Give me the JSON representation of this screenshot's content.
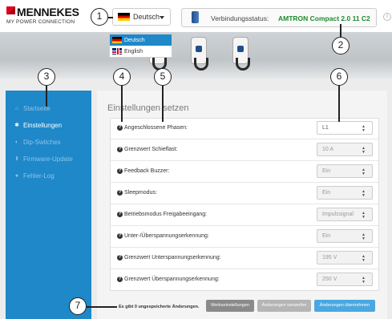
{
  "header": {
    "logo_brand": "MENNEKES",
    "logo_tagline": "MY POWER CONNECTION",
    "language_current": "Deutsch",
    "language_options": [
      "Deutsch",
      "English"
    ],
    "status_label": "Verbindungsstatus:",
    "status_value": "AMTRON Compact 2.0 11 C2",
    "info_icon": "i"
  },
  "sidebar": {
    "items": [
      {
        "label": "Startseite",
        "icon": "home-icon",
        "glyph": "⌂"
      },
      {
        "label": "Einstellungen",
        "icon": "gear-icon",
        "glyph": "✱"
      },
      {
        "label": "Dip-Switches",
        "icon": "toggle-icon",
        "glyph": "◐"
      },
      {
        "label": "Firmware-Update",
        "icon": "upload-icon",
        "glyph": "⬆"
      },
      {
        "label": "Fehler-Log",
        "icon": "alert-icon",
        "glyph": "●"
      }
    ]
  },
  "main": {
    "title": "Einstellungen setzen",
    "settings": [
      {
        "label": "Angeschlossene Phasen:",
        "value": "L1"
      },
      {
        "label": "Grenzwert Schieflast:",
        "value": "10 A"
      },
      {
        "label": "Feedback Buzzer:",
        "value": "Ein"
      },
      {
        "label": "Sleepmodus:",
        "value": "Ein"
      },
      {
        "label": "Betriebsmodus Freigabeeingang:",
        "value": "Impulssignal"
      },
      {
        "label": "Unter-/Überspannungserkennung:",
        "value": "Ein"
      },
      {
        "label": "Grenzwert Unterspannungserkennung:",
        "value": "195 V"
      },
      {
        "label": "Grenzwert Überspannungserkennung:",
        "value": "250 V"
      }
    ],
    "unsaved_text": "Es gibt 0 ungespeicherte Änderungen.",
    "btn_factory": "Werkseinstellungen",
    "btn_discard": "Änderungen verwerfen",
    "btn_apply": "Änderungen übernehmen"
  },
  "callouts": [
    "1",
    "2",
    "3",
    "4",
    "5",
    "6",
    "7"
  ],
  "colors": {
    "accent": "#1e88c9",
    "status_green": "#1e8a2e",
    "button_gray": "#8a8a8a",
    "button_disabled": "#b5b5b5",
    "button_blue": "#4aa8e0"
  }
}
